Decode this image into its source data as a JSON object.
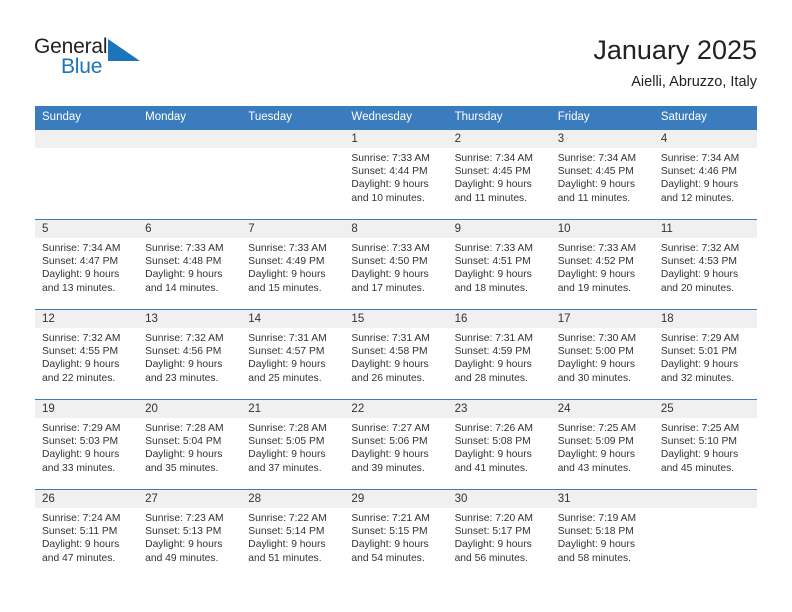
{
  "logo": {
    "word_top": "General",
    "word_bottom": "Blue",
    "triangle_color": "#1b75bb",
    "text_color": "#231f20"
  },
  "header": {
    "title": "January 2025",
    "subtitle": "Aielli, Abruzzo, Italy"
  },
  "theme": {
    "header_bg": "#3a7cbe",
    "header_text": "#ffffff",
    "daynum_band_bg": "#f0f0f0",
    "row_divider": "#3a7cbe",
    "body_text": "#333333"
  },
  "weekday_headers": [
    "Sunday",
    "Monday",
    "Tuesday",
    "Wednesday",
    "Thursday",
    "Friday",
    "Saturday"
  ],
  "weeks": [
    [
      {
        "day": "",
        "sunrise": "",
        "sunset": "",
        "daylight_1": "",
        "daylight_2": ""
      },
      {
        "day": "",
        "sunrise": "",
        "sunset": "",
        "daylight_1": "",
        "daylight_2": ""
      },
      {
        "day": "",
        "sunrise": "",
        "sunset": "",
        "daylight_1": "",
        "daylight_2": ""
      },
      {
        "day": "1",
        "sunrise": "Sunrise: 7:33 AM",
        "sunset": "Sunset: 4:44 PM",
        "daylight_1": "Daylight: 9 hours",
        "daylight_2": "and 10 minutes."
      },
      {
        "day": "2",
        "sunrise": "Sunrise: 7:34 AM",
        "sunset": "Sunset: 4:45 PM",
        "daylight_1": "Daylight: 9 hours",
        "daylight_2": "and 11 minutes."
      },
      {
        "day": "3",
        "sunrise": "Sunrise: 7:34 AM",
        "sunset": "Sunset: 4:45 PM",
        "daylight_1": "Daylight: 9 hours",
        "daylight_2": "and 11 minutes."
      },
      {
        "day": "4",
        "sunrise": "Sunrise: 7:34 AM",
        "sunset": "Sunset: 4:46 PM",
        "daylight_1": "Daylight: 9 hours",
        "daylight_2": "and 12 minutes."
      }
    ],
    [
      {
        "day": "5",
        "sunrise": "Sunrise: 7:34 AM",
        "sunset": "Sunset: 4:47 PM",
        "daylight_1": "Daylight: 9 hours",
        "daylight_2": "and 13 minutes."
      },
      {
        "day": "6",
        "sunrise": "Sunrise: 7:33 AM",
        "sunset": "Sunset: 4:48 PM",
        "daylight_1": "Daylight: 9 hours",
        "daylight_2": "and 14 minutes."
      },
      {
        "day": "7",
        "sunrise": "Sunrise: 7:33 AM",
        "sunset": "Sunset: 4:49 PM",
        "daylight_1": "Daylight: 9 hours",
        "daylight_2": "and 15 minutes."
      },
      {
        "day": "8",
        "sunrise": "Sunrise: 7:33 AM",
        "sunset": "Sunset: 4:50 PM",
        "daylight_1": "Daylight: 9 hours",
        "daylight_2": "and 17 minutes."
      },
      {
        "day": "9",
        "sunrise": "Sunrise: 7:33 AM",
        "sunset": "Sunset: 4:51 PM",
        "daylight_1": "Daylight: 9 hours",
        "daylight_2": "and 18 minutes."
      },
      {
        "day": "10",
        "sunrise": "Sunrise: 7:33 AM",
        "sunset": "Sunset: 4:52 PM",
        "daylight_1": "Daylight: 9 hours",
        "daylight_2": "and 19 minutes."
      },
      {
        "day": "11",
        "sunrise": "Sunrise: 7:32 AM",
        "sunset": "Sunset: 4:53 PM",
        "daylight_1": "Daylight: 9 hours",
        "daylight_2": "and 20 minutes."
      }
    ],
    [
      {
        "day": "12",
        "sunrise": "Sunrise: 7:32 AM",
        "sunset": "Sunset: 4:55 PM",
        "daylight_1": "Daylight: 9 hours",
        "daylight_2": "and 22 minutes."
      },
      {
        "day": "13",
        "sunrise": "Sunrise: 7:32 AM",
        "sunset": "Sunset: 4:56 PM",
        "daylight_1": "Daylight: 9 hours",
        "daylight_2": "and 23 minutes."
      },
      {
        "day": "14",
        "sunrise": "Sunrise: 7:31 AM",
        "sunset": "Sunset: 4:57 PM",
        "daylight_1": "Daylight: 9 hours",
        "daylight_2": "and 25 minutes."
      },
      {
        "day": "15",
        "sunrise": "Sunrise: 7:31 AM",
        "sunset": "Sunset: 4:58 PM",
        "daylight_1": "Daylight: 9 hours",
        "daylight_2": "and 26 minutes."
      },
      {
        "day": "16",
        "sunrise": "Sunrise: 7:31 AM",
        "sunset": "Sunset: 4:59 PM",
        "daylight_1": "Daylight: 9 hours",
        "daylight_2": "and 28 minutes."
      },
      {
        "day": "17",
        "sunrise": "Sunrise: 7:30 AM",
        "sunset": "Sunset: 5:00 PM",
        "daylight_1": "Daylight: 9 hours",
        "daylight_2": "and 30 minutes."
      },
      {
        "day": "18",
        "sunrise": "Sunrise: 7:29 AM",
        "sunset": "Sunset: 5:01 PM",
        "daylight_1": "Daylight: 9 hours",
        "daylight_2": "and 32 minutes."
      }
    ],
    [
      {
        "day": "19",
        "sunrise": "Sunrise: 7:29 AM",
        "sunset": "Sunset: 5:03 PM",
        "daylight_1": "Daylight: 9 hours",
        "daylight_2": "and 33 minutes."
      },
      {
        "day": "20",
        "sunrise": "Sunrise: 7:28 AM",
        "sunset": "Sunset: 5:04 PM",
        "daylight_1": "Daylight: 9 hours",
        "daylight_2": "and 35 minutes."
      },
      {
        "day": "21",
        "sunrise": "Sunrise: 7:28 AM",
        "sunset": "Sunset: 5:05 PM",
        "daylight_1": "Daylight: 9 hours",
        "daylight_2": "and 37 minutes."
      },
      {
        "day": "22",
        "sunrise": "Sunrise: 7:27 AM",
        "sunset": "Sunset: 5:06 PM",
        "daylight_1": "Daylight: 9 hours",
        "daylight_2": "and 39 minutes."
      },
      {
        "day": "23",
        "sunrise": "Sunrise: 7:26 AM",
        "sunset": "Sunset: 5:08 PM",
        "daylight_1": "Daylight: 9 hours",
        "daylight_2": "and 41 minutes."
      },
      {
        "day": "24",
        "sunrise": "Sunrise: 7:25 AM",
        "sunset": "Sunset: 5:09 PM",
        "daylight_1": "Daylight: 9 hours",
        "daylight_2": "and 43 minutes."
      },
      {
        "day": "25",
        "sunrise": "Sunrise: 7:25 AM",
        "sunset": "Sunset: 5:10 PM",
        "daylight_1": "Daylight: 9 hours",
        "daylight_2": "and 45 minutes."
      }
    ],
    [
      {
        "day": "26",
        "sunrise": "Sunrise: 7:24 AM",
        "sunset": "Sunset: 5:11 PM",
        "daylight_1": "Daylight: 9 hours",
        "daylight_2": "and 47 minutes."
      },
      {
        "day": "27",
        "sunrise": "Sunrise: 7:23 AM",
        "sunset": "Sunset: 5:13 PM",
        "daylight_1": "Daylight: 9 hours",
        "daylight_2": "and 49 minutes."
      },
      {
        "day": "28",
        "sunrise": "Sunrise: 7:22 AM",
        "sunset": "Sunset: 5:14 PM",
        "daylight_1": "Daylight: 9 hours",
        "daylight_2": "and 51 minutes."
      },
      {
        "day": "29",
        "sunrise": "Sunrise: 7:21 AM",
        "sunset": "Sunset: 5:15 PM",
        "daylight_1": "Daylight: 9 hours",
        "daylight_2": "and 54 minutes."
      },
      {
        "day": "30",
        "sunrise": "Sunrise: 7:20 AM",
        "sunset": "Sunset: 5:17 PM",
        "daylight_1": "Daylight: 9 hours",
        "daylight_2": "and 56 minutes."
      },
      {
        "day": "31",
        "sunrise": "Sunrise: 7:19 AM",
        "sunset": "Sunset: 5:18 PM",
        "daylight_1": "Daylight: 9 hours",
        "daylight_2": "and 58 minutes."
      },
      {
        "day": "",
        "sunrise": "",
        "sunset": "",
        "daylight_1": "",
        "daylight_2": ""
      }
    ]
  ]
}
